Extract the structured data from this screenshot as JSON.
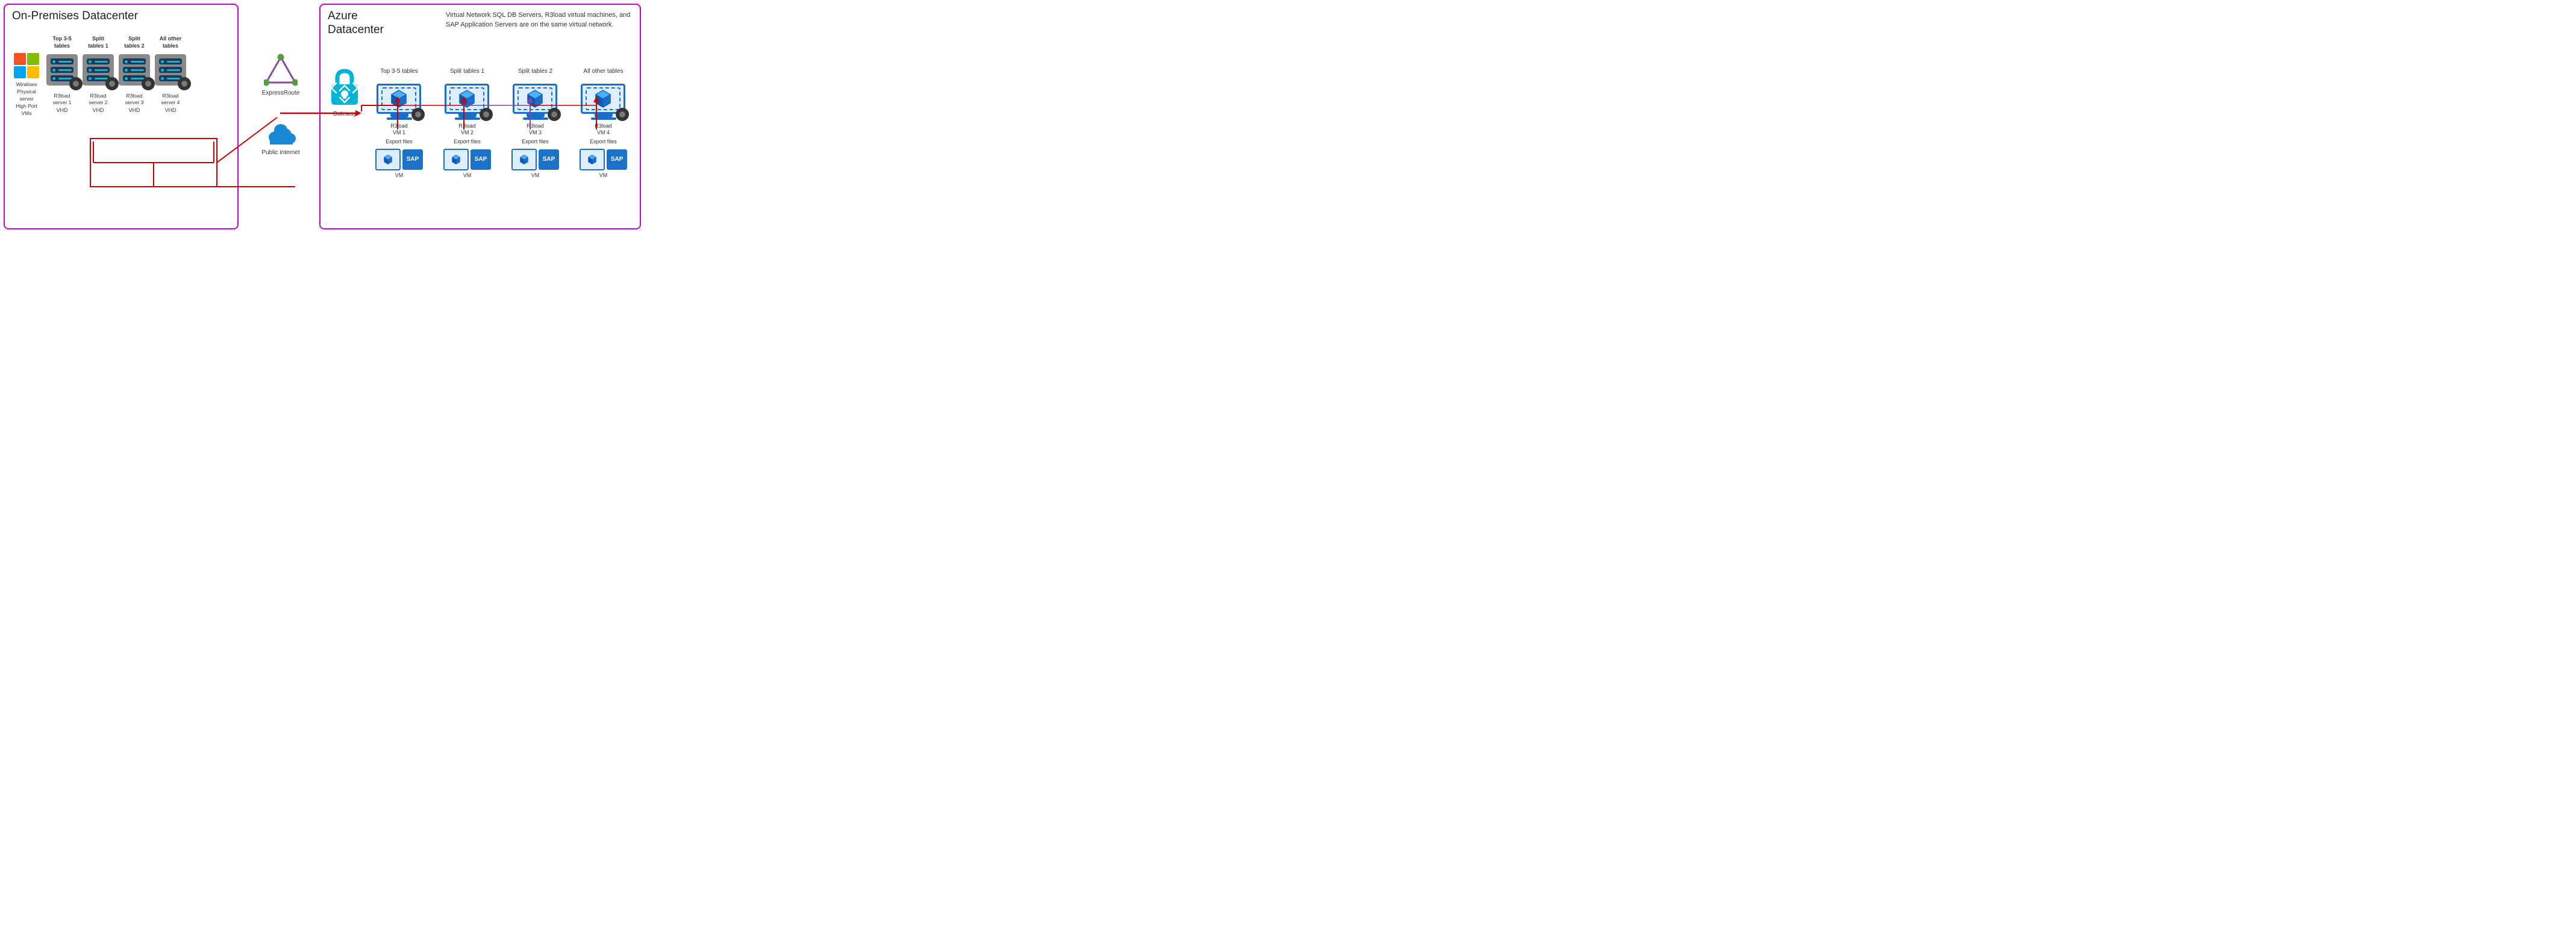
{
  "onprem": {
    "title": "On-Premises Datacenter",
    "windows_label": "Windows\nPhysical\nserver\nHigh Port\nVMs",
    "servers": [
      {
        "label": "Top 3-5\ntables",
        "r3load": "R3load\nserver 1",
        "vhd": "VHD"
      },
      {
        "label": "Split\ntables 1",
        "r3load": "R3load\nserver 2",
        "vhd": "VHD"
      },
      {
        "label": "Split\ntables 2",
        "r3load": "R3load\nserver 3",
        "vhd": "VHD"
      },
      {
        "label": "All other\ntables",
        "r3load": "R3load\nserver 4",
        "vhd": "VHD"
      }
    ]
  },
  "middle": {
    "expressroute_label": "ExpressRoute",
    "public_internet_label": "Public\ninternet"
  },
  "azure": {
    "title": "Azure\nDatacenter",
    "note": "Virtual Network SQL DB Servers, R3load virtual machines, and\nSAP Application Servers are on the same virtual network.",
    "gateway_label": "Gateway",
    "vm_groups": [
      {
        "title": "Top 3-5 tables",
        "r3load": "R3load\nVM 1",
        "export": "Export files",
        "vm": "VM"
      },
      {
        "title": "Split tables 1",
        "r3load": "R3load\nVM 2",
        "export": "Export files",
        "vm": "VM"
      },
      {
        "title": "Split tables 2",
        "r3load": "R3load\nVM 3",
        "export": "Export files",
        "vm": "VM"
      },
      {
        "title": "All other tables",
        "r3load": "R3load\nVM 4",
        "export": "Export files",
        "vm": "VM"
      }
    ]
  },
  "colors": {
    "border_magenta": "#cc00cc",
    "red_line": "#cc0000",
    "purple_line": "#8844aa",
    "blue_monitor": "#1a6ec7",
    "cyan": "#00bcd4",
    "gateway_cyan": "#00b4d8"
  }
}
